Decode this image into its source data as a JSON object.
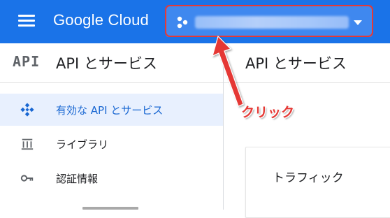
{
  "topbar": {
    "logo": "Google Cloud",
    "accent_color": "#1a73e8",
    "menu_icon": "hamburger-menu-icon",
    "project_picker": {
      "icon": "project-dots-icon",
      "dropdown_icon": "caret-down-icon"
    }
  },
  "sidebar": {
    "logo_text": "API",
    "title": "API とサービス",
    "items": [
      {
        "label": "有効な API とサービス",
        "icon": "enabled-apis-icon",
        "active": true
      },
      {
        "label": "ライブラリ",
        "icon": "library-icon",
        "active": false
      },
      {
        "label": "認証情報",
        "icon": "key-icon",
        "active": false
      }
    ]
  },
  "main": {
    "title": "API とサービス",
    "card_title": "トラフィック"
  },
  "annotation": {
    "label": "クリック",
    "color": "#e53935"
  }
}
